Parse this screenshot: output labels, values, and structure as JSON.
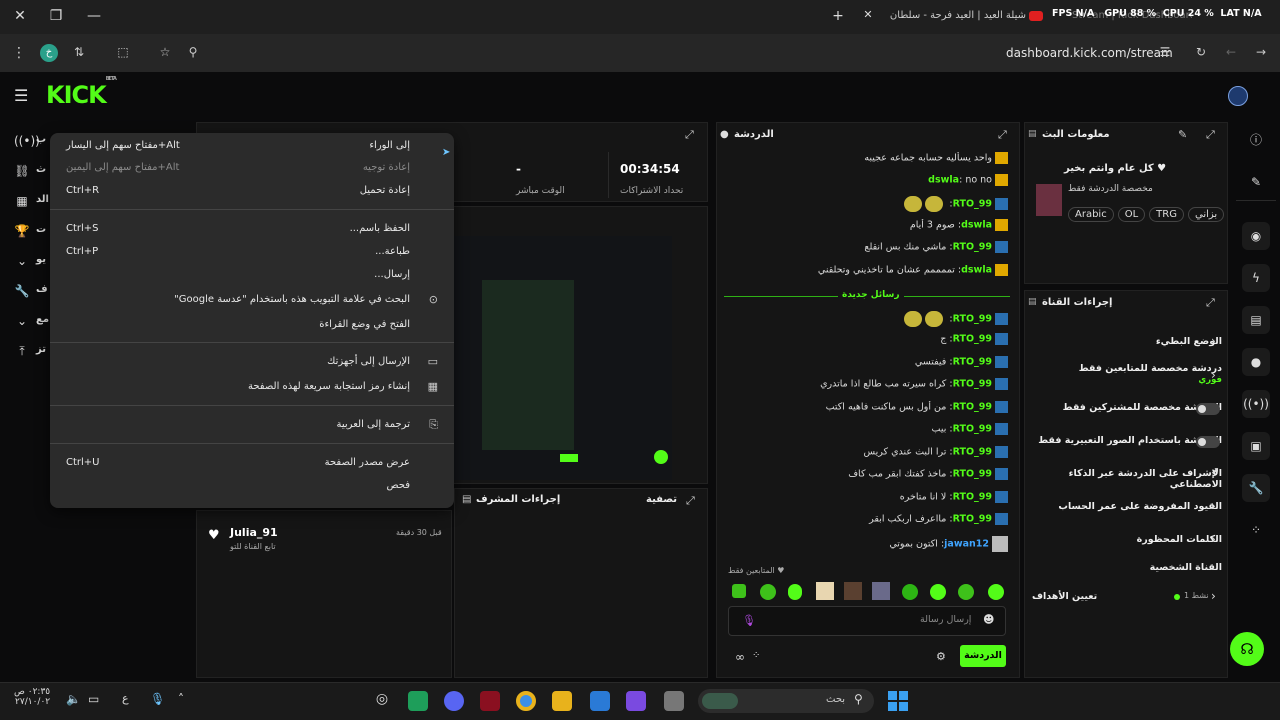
{
  "titlebar": {
    "tabs": [
      {
        "title": "شيلة العيد | العيد فرحة - سلطان"
      },
      {
        "title": "Stream | Kick Dashboard"
      }
    ],
    "overlay": {
      "fps": "FPS N/A",
      "gpu": "GPU 88 %",
      "cpu": "CPU 24 %",
      "lat": "LAT N/A"
    }
  },
  "addressbar": {
    "url": "dashboard.kick.com/stream",
    "profile_initial": "خ"
  },
  "brand": {
    "logo": "KICK",
    "beta": "BETA"
  },
  "left_rail": [
    "ب",
    "ث",
    "الد",
    "ت",
    "يو",
    "ف",
    "مع",
    "تز"
  ],
  "stream_stats": {
    "live_time": "00:34:54",
    "live_time_label": "الوقت مباشر",
    "subs_value": "-",
    "subs_label": "تحداد الاشتراكات"
  },
  "context_menu": {
    "items": [
      {
        "label": "إلى الوراء",
        "shortcut": "مفتاح سهم إلى اليسار+Alt",
        "disabled": false
      },
      {
        "label": "إعادة توجيه",
        "shortcut": "مفتاح سهم إلى اليمين+Alt",
        "disabled": true
      },
      {
        "label": "إعادة تحميل",
        "shortcut": "Ctrl+R",
        "disabled": false
      },
      {
        "label": "الحفظ باسم...",
        "shortcut": "Ctrl+S",
        "disabled": false
      },
      {
        "label": "طباعة...",
        "shortcut": "Ctrl+P",
        "disabled": false
      },
      {
        "label": "إرسال...",
        "shortcut": "",
        "disabled": false
      },
      {
        "label": "البحث في علامة التبويب هذه باستخدام \"عدسة Google\"",
        "shortcut": "",
        "disabled": false
      },
      {
        "label": "الفتح في وضع القراءة",
        "shortcut": "",
        "disabled": false
      },
      {
        "label": "الإرسال إلى أجهزتك",
        "shortcut": "",
        "disabled": false
      },
      {
        "label": "إنشاء رمز استجابة سريعة لهذه الصفحة",
        "shortcut": "",
        "disabled": false
      },
      {
        "label": "ترجمة إلى العربية",
        "shortcut": "",
        "disabled": false
      },
      {
        "label": "عرض مصدر الصفحة",
        "shortcut": "Ctrl+U",
        "disabled": false
      },
      {
        "label": "فحص",
        "shortcut": "",
        "disabled": false
      }
    ]
  },
  "activity": {
    "user": "Julia_91",
    "sub": "تابع القناة للتو",
    "time": "قبل 30 دقيقة"
  },
  "mod_panel": {
    "title": "إجراءات المشرف",
    "filter": "تصفية"
  },
  "chat": {
    "title": "الدردشة",
    "new_messages_label": "رسائل جديدة",
    "messages": [
      {
        "badge": "crown",
        "user": "",
        "text": "واحد يسأليه حسابه جماعه عجيبه",
        "color": "#ddd"
      },
      {
        "badge": "crown",
        "user": "dswla",
        "text": "no no",
        "color": "#53fc18"
      },
      {
        "badge": "kick",
        "user": "RTO_99",
        "text": "",
        "emotes": 2,
        "color": "#53fc18"
      },
      {
        "badge": "crown",
        "user": "dswla",
        "text": "صوم 3 أيام",
        "color": "#53fc18"
      },
      {
        "badge": "kick",
        "user": "RTO_99",
        "text": "ماشي منك بس انقلع",
        "color": "#53fc18"
      },
      {
        "badge": "crown",
        "user": "dswla",
        "text": "تممممم عشان ما تاخذيني وتحلقني",
        "color": "#53fc18"
      },
      {
        "badge": "kick",
        "user": "RTO_99",
        "text": "",
        "emotes": 2,
        "color": "#53fc18"
      },
      {
        "badge": "kick",
        "user": "RTO_99",
        "text": "ج",
        "color": "#53fc18"
      },
      {
        "badge": "kick",
        "user": "RTO_99",
        "text": "فيفتسي",
        "color": "#53fc18"
      },
      {
        "badge": "kick",
        "user": "RTO_99",
        "text": "كراه سيرته مب طالع اذا ماتدري",
        "color": "#53fc18"
      },
      {
        "badge": "kick",
        "user": "RTO_99",
        "text": "من أول بس ماكنت فاهيه اكتب",
        "color": "#53fc18"
      },
      {
        "badge": "kick",
        "user": "RTO_99",
        "text": "بيب",
        "color": "#53fc18"
      },
      {
        "badge": "kick",
        "user": "RTO_99",
        "text": "ترا البث عندي كريس",
        "color": "#53fc18"
      },
      {
        "badge": "kick",
        "user": "RTO_99",
        "text": "ماخذ كفتك ابقر مب كاف",
        "color": "#53fc18"
      },
      {
        "badge": "kick",
        "user": "RTO_99",
        "text": "لا انا متاخره",
        "color": "#53fc18"
      },
      {
        "badge": "kick",
        "user": "RTO_99",
        "text": "مااعرف اربكب ابقر",
        "color": "#53fc18"
      },
      {
        "badge": "avatar",
        "user": "jawan12",
        "text": "اكتون بموتي",
        "color": "#3fa4ff"
      }
    ],
    "followers_only": "المتابعين فقط",
    "input_placeholder": "إرسال رسالة",
    "send_label": "الدردشة"
  },
  "stream_info": {
    "title": "معلومات البث",
    "stream_title": "كل عام وانتم بخير",
    "chat_mode": "مخصصة الدردشة فقط",
    "tags": [
      "Arabic",
      "OL",
      "TRG",
      "بزاني"
    ]
  },
  "channel_actions": {
    "title": "إجراءات القناة",
    "rows": [
      {
        "label": "الوضع البطيء",
        "control": "chevron"
      },
      {
        "label": "دردشة مخصصة للمتابعين فقط",
        "sub": "فوري",
        "control": "chevron"
      },
      {
        "label": "الدردشة مخصصة للمشتركين فقط",
        "control": "toggle"
      },
      {
        "label": "الدردشة باستخدام الصور التعبيرية فقط",
        "control": "toggle"
      },
      {
        "label": "الإشراف على الدردشة عبر الذكاء الاصطناعي",
        "control": "external"
      },
      {
        "label": "القيود المفروضة على عمر الحساب",
        "control": "chevron"
      },
      {
        "label": "الكلمات المحظورة",
        "control": "chevron"
      }
    ],
    "personal_channel": "القناة الشخصية",
    "goals_label": "تعيين الأهداف",
    "goals_status": "نشط 1"
  },
  "taskbar": {
    "time": "٠٢:٣٥ ص",
    "date": "٢٧/١٠/٠٢",
    "lang": "ع",
    "search_label": "بحث"
  },
  "colors": {
    "accent": "#53fc18",
    "bg": "#0b0b0c",
    "panel": "#151515"
  }
}
